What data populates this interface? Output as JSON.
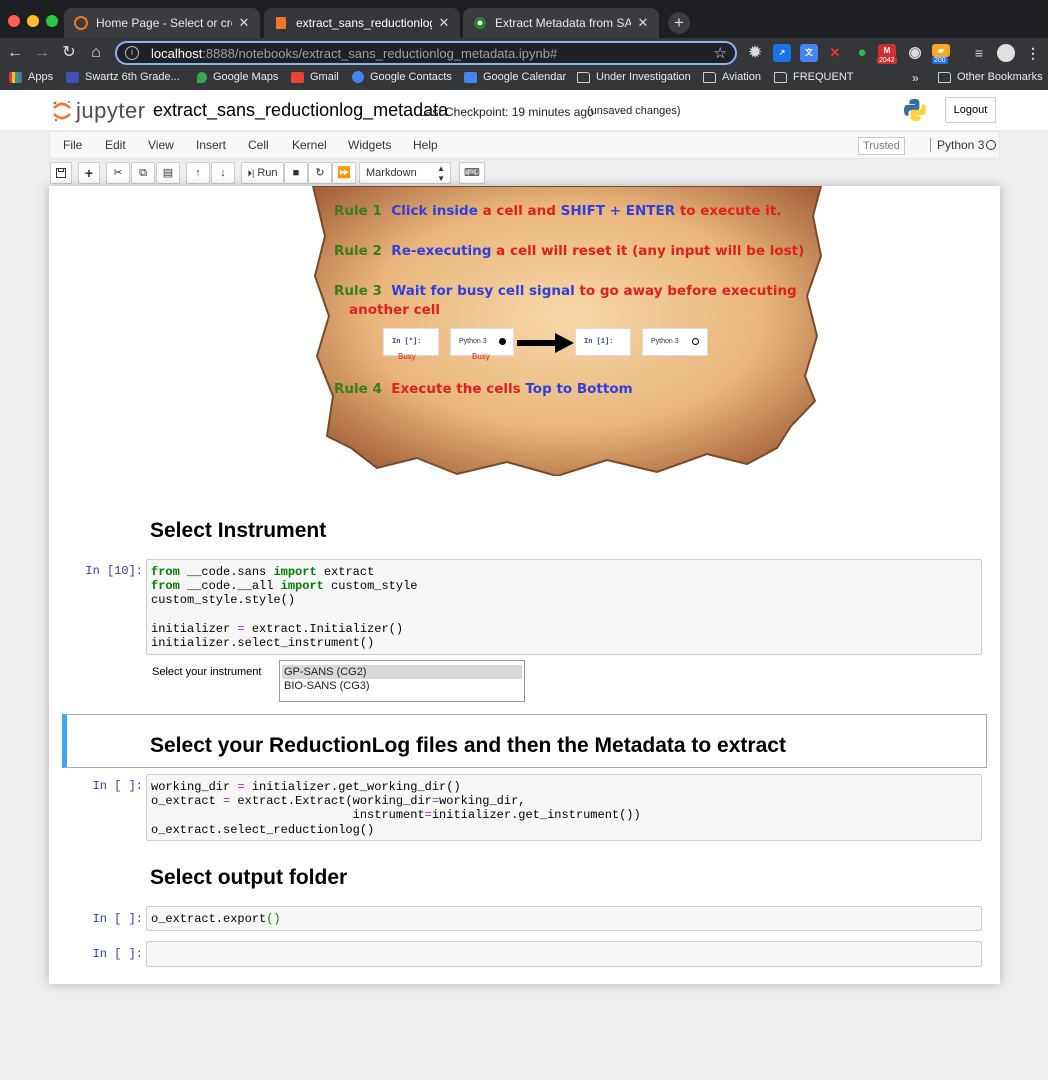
{
  "browser": {
    "tabs": [
      {
        "title": "Home Page - Select or create a notebook",
        "active": false
      },
      {
        "title": "extract_sans_reductionlog_metadata",
        "active": true
      },
      {
        "title": "Extract Metadata from SANS ReductionLog",
        "active": false
      }
    ],
    "url_host": "localhost",
    "url_path": ":8888/notebooks/extract_sans_reductionlog_metadata.ipynb#",
    "badges": {
      "red": "2042",
      "blue": "200"
    },
    "bookmarks": [
      {
        "label": "Apps",
        "icon": "apps-icon"
      },
      {
        "label": "Swartz 6th Grade...",
        "icon": "calendar-icon"
      },
      {
        "label": "Google Maps",
        "icon": "maps-icon"
      },
      {
        "label": "Gmail",
        "icon": "gmail-icon"
      },
      {
        "label": "Google Contacts",
        "icon": "contacts-icon"
      },
      {
        "label": "Google Calendar",
        "icon": "calendar-icon"
      },
      {
        "label": "Under Investigation",
        "icon": "folder-icon"
      },
      {
        "label": "Aviation",
        "icon": "folder-icon"
      },
      {
        "label": "FREQUENT",
        "icon": "folder-icon"
      }
    ],
    "bookmarks_more": "»",
    "other_bookmarks": "Other Bookmarks"
  },
  "jupyter": {
    "logo_text": "jupyter",
    "notebook_name": "extract_sans_reductionlog_metadata",
    "checkpoint": "Last Checkpoint: 19 minutes ago",
    "unsaved": "(unsaved changes)",
    "logout": "Logout",
    "menu": [
      "File",
      "Edit",
      "View",
      "Insert",
      "Cell",
      "Kernel",
      "Widgets",
      "Help"
    ],
    "trusted": "Trusted",
    "kernel": "Python 3",
    "run_label": "Run",
    "cell_type": "Markdown"
  },
  "rules_image": {
    "rule1_num": "Rule 1",
    "rule1_a": "Click inside",
    "rule1_b": "a cell and",
    "rule1_c": "SHIFT + ENTER",
    "rule1_d": "to execute it.",
    "rule2_num": "Rule 2",
    "rule2_a": "Re-executing",
    "rule2_b": "a cell will reset it (any input will be lost)",
    "rule3_num": "Rule 3",
    "rule3_a": "Wait for busy cell signal",
    "rule3_b": "to go away before executing",
    "rule3_c": "another cell",
    "busy_prompt": "In [*]:",
    "done_prompt": "In [1]:",
    "kernel_label": "Python 3",
    "busy": "Busy",
    "rule4_num": "Rule 4",
    "rule4_a": "Execute the cells",
    "rule4_b": "Top to Bottom"
  },
  "notebook": {
    "heading1": "Select Instrument",
    "cell1_prompt": "In [10]:",
    "instrument_label": "Select your instrument",
    "instrument_options": [
      "GP-SANS (CG2)",
      "BIO-SANS (CG3)"
    ],
    "heading2": "Select your ReductionLog files and then the Metadata to extract",
    "cell2_prompt": "In [ ]:",
    "heading3": "Select output folder",
    "cell3_prompt": "In [ ]:",
    "cell4_prompt": "In [ ]:"
  }
}
